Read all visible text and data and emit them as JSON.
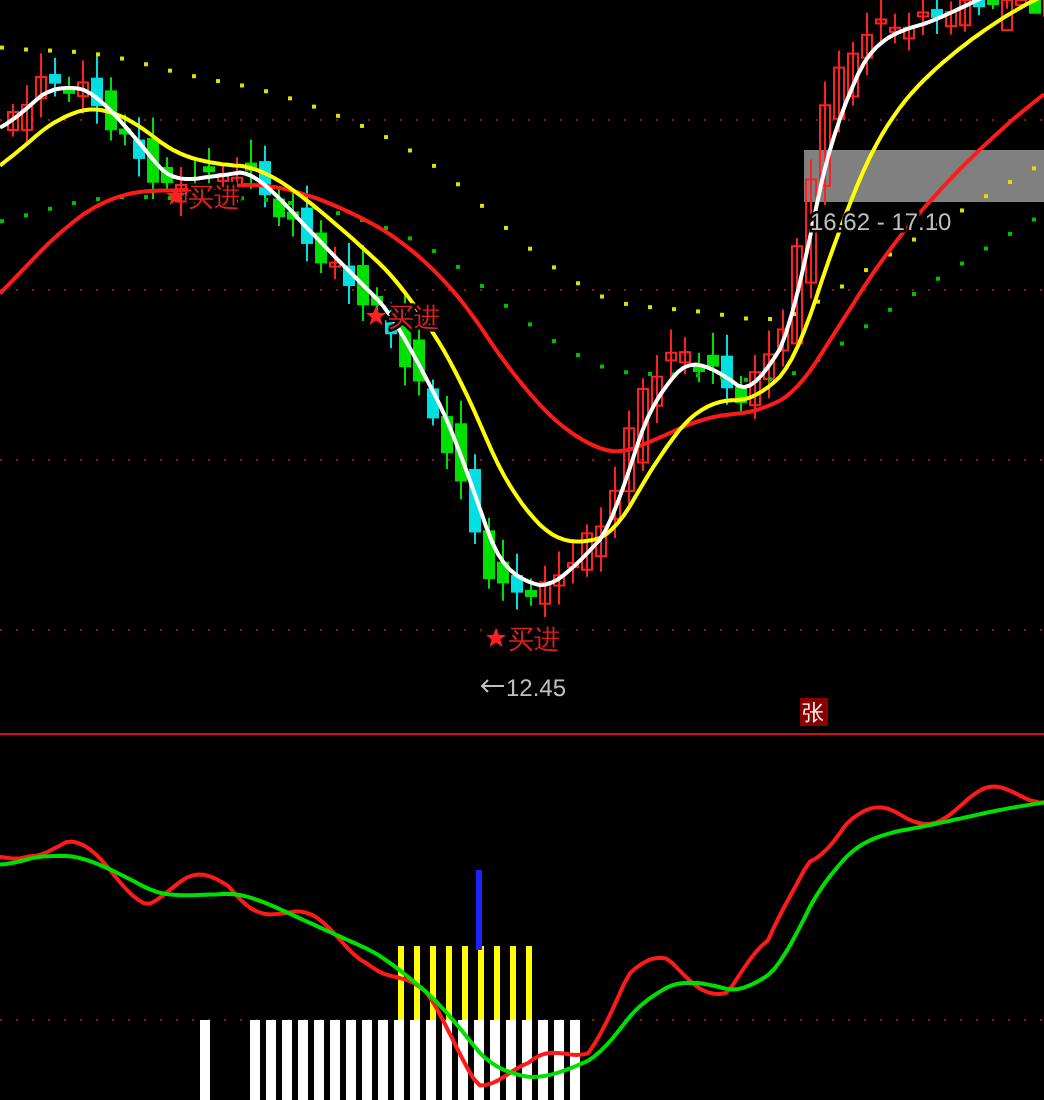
{
  "main_chart": {
    "signals": [
      {
        "label": "买进"
      },
      {
        "label": "买进"
      },
      {
        "label": "买进"
      }
    ],
    "low_price": "12.45",
    "price_range": "16.62 - 17.10",
    "badge": "张"
  }
}
